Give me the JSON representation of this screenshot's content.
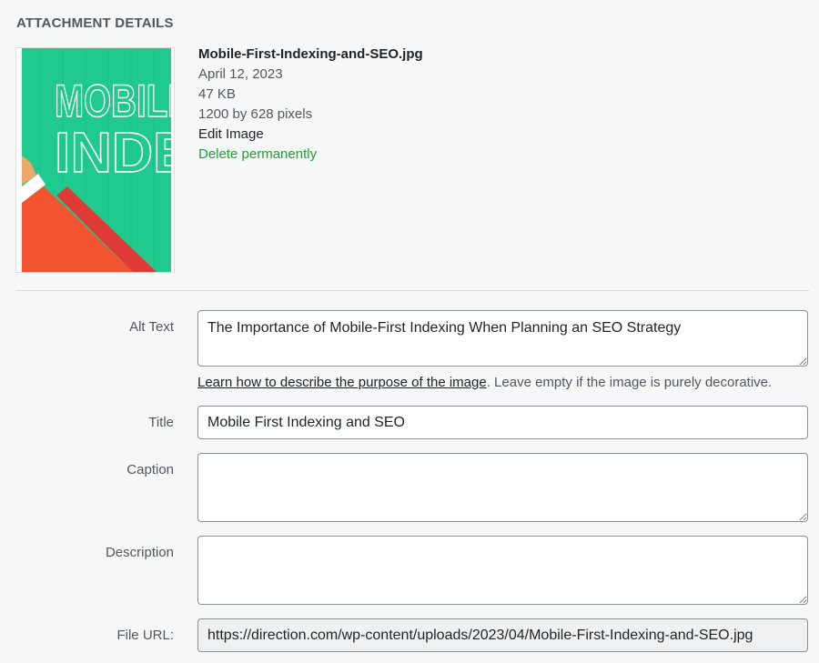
{
  "header": {
    "title": "ATTACHMENT DETAILS"
  },
  "thumbnail": {
    "line1": "MOBILE",
    "line2": "INDE",
    "colors": {
      "background": "#20c98d",
      "sleeve": "#f25430",
      "cuff": "#ffffff",
      "hand": "#f0a86a"
    }
  },
  "details": {
    "filename": "Mobile-First-Indexing-and-SEO.jpg",
    "date": "April 12, 2023",
    "filesize": "47 KB",
    "dimensions": "1200 by 628 pixels",
    "edit_link": "Edit Image",
    "delete_link": "Delete permanently"
  },
  "form": {
    "alt_text": {
      "label": "Alt Text",
      "value": "The Importance of Mobile-First Indexing When Planning an SEO Strategy"
    },
    "help": {
      "link": "Learn how to describe the purpose of the image",
      "suffix": ". Leave empty if the image is purely decorative."
    },
    "title": {
      "label": "Title",
      "value": "Mobile First Indexing and SEO"
    },
    "caption": {
      "label": "Caption",
      "value": ""
    },
    "description": {
      "label": "Description",
      "value": ""
    },
    "file_url": {
      "label": "File URL:",
      "value": "https://direction.com/wp-content/uploads/2023/04/Mobile-First-Indexing-and-SEO.jpg"
    }
  },
  "colors": {
    "link_delete": "#1ea032",
    "background": "#f6f7f7"
  }
}
